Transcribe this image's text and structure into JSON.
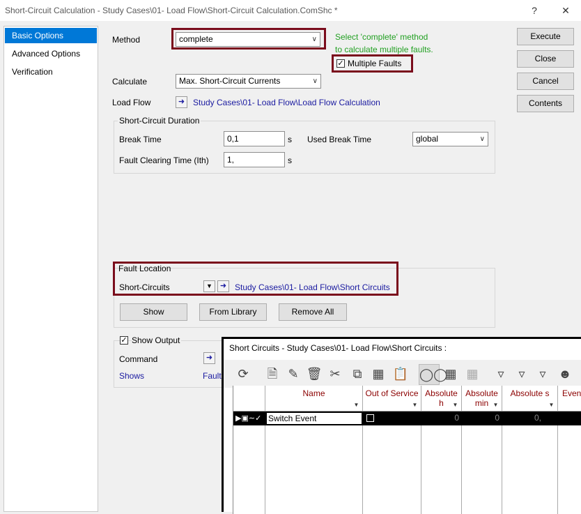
{
  "window": {
    "title": "Short-Circuit Calculation - Study Cases\\01- Load Flow\\Short-Circuit Calculation.ComShc *",
    "help_glyph": "?",
    "close_glyph": "✕"
  },
  "sidebar": {
    "items": [
      {
        "label": "Basic Options",
        "active": true
      },
      {
        "label": "Advanced Options",
        "active": false
      },
      {
        "label": "Verification",
        "active": false
      }
    ]
  },
  "form": {
    "method_label": "Method",
    "method_value": "complete",
    "hint_line1": "Select 'complete' method",
    "hint_line2": "to calculate multiple faults.",
    "multiple_faults_label": "Multiple Faults",
    "multiple_faults_checked": true,
    "calculate_label": "Calculate",
    "calculate_value": "Max. Short-Circuit Currents",
    "load_flow_label": "Load Flow",
    "load_flow_link": "Study Cases\\01- Load Flow\\Load Flow Calculation"
  },
  "duration": {
    "group_label": "Short-Circuit Duration",
    "break_time_label": "Break Time",
    "break_time_value": "0,1",
    "break_time_unit": "s",
    "used_break_time_label": "Used Break Time",
    "used_break_time_value": "global",
    "fault_clearing_label": "Fault Clearing Time (Ith)",
    "fault_clearing_value": "1,",
    "fault_clearing_unit": "s"
  },
  "fault_location": {
    "group_label": "Fault Location",
    "short_circuits_label": "Short-Circuits",
    "short_circuits_link": "Study Cases\\01- Load Flow\\Short Circuits",
    "show_button": "Show",
    "from_library_button": "From Library",
    "remove_all_button": "Remove All"
  },
  "output": {
    "show_output_label": "Show Output",
    "show_output_checked": true,
    "command_label": "Command",
    "shows_label": "Shows",
    "shows_value": "Fault"
  },
  "buttons": {
    "execute": "Execute",
    "close": "Close",
    "cancel": "Cancel",
    "contents": "Contents"
  },
  "overlay": {
    "title": "Short Circuits - Study Cases\\01- Load Flow\\Short Circuits :",
    "toolbar_icons": [
      "refresh-icon",
      "new-object-icon",
      "edit-icon",
      "delete-icon",
      "cut-icon",
      "copy-icon",
      "spreadsheet-icon",
      "paste-icon",
      "detail-mode-icon",
      "table-view-icon",
      "table-alt-icon",
      "filter-icon",
      "filter-advanced-icon",
      "filter-time-icon",
      "users-icon"
    ],
    "columns": [
      {
        "label": "Name"
      },
      {
        "label": "Out of Service"
      },
      {
        "label": "Absolute h"
      },
      {
        "label": "Absolute min"
      },
      {
        "label": "Absolute s"
      },
      {
        "label": "Event"
      }
    ],
    "rows": [
      {
        "name": "Switch Event",
        "out_of_service": false,
        "abs_h": "0",
        "abs_min": "0",
        "abs_s": "0,"
      }
    ]
  }
}
